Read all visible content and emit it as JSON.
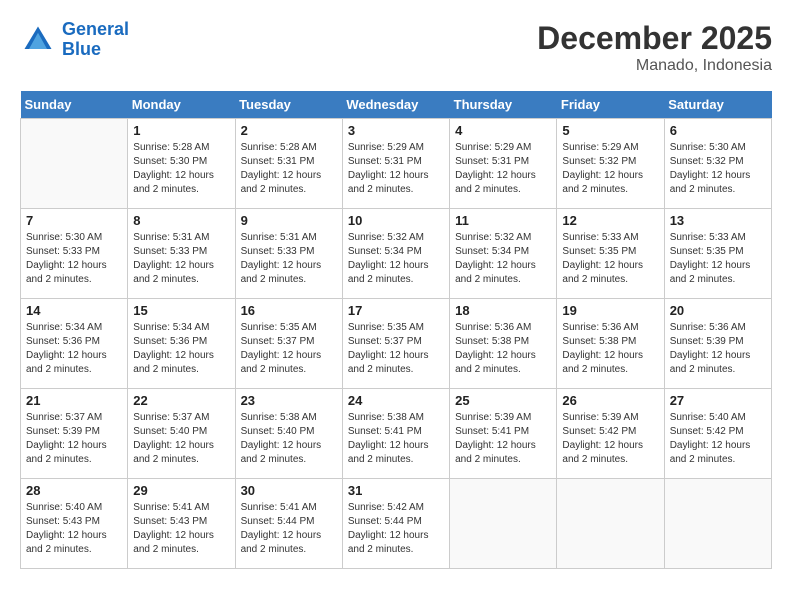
{
  "header": {
    "logo_line1": "General",
    "logo_line2": "Blue",
    "month": "December 2025",
    "location": "Manado, Indonesia"
  },
  "days_of_week": [
    "Sunday",
    "Monday",
    "Tuesday",
    "Wednesday",
    "Thursday",
    "Friday",
    "Saturday"
  ],
  "weeks": [
    [
      {
        "day": "",
        "info": ""
      },
      {
        "day": "1",
        "info": "Sunrise: 5:28 AM\nSunset: 5:30 PM\nDaylight: 12 hours\nand 2 minutes."
      },
      {
        "day": "2",
        "info": "Sunrise: 5:28 AM\nSunset: 5:31 PM\nDaylight: 12 hours\nand 2 minutes."
      },
      {
        "day": "3",
        "info": "Sunrise: 5:29 AM\nSunset: 5:31 PM\nDaylight: 12 hours\nand 2 minutes."
      },
      {
        "day": "4",
        "info": "Sunrise: 5:29 AM\nSunset: 5:31 PM\nDaylight: 12 hours\nand 2 minutes."
      },
      {
        "day": "5",
        "info": "Sunrise: 5:29 AM\nSunset: 5:32 PM\nDaylight: 12 hours\nand 2 minutes."
      },
      {
        "day": "6",
        "info": "Sunrise: 5:30 AM\nSunset: 5:32 PM\nDaylight: 12 hours\nand 2 minutes."
      }
    ],
    [
      {
        "day": "7",
        "info": "Sunrise: 5:30 AM\nSunset: 5:33 PM\nDaylight: 12 hours\nand 2 minutes."
      },
      {
        "day": "8",
        "info": "Sunrise: 5:31 AM\nSunset: 5:33 PM\nDaylight: 12 hours\nand 2 minutes."
      },
      {
        "day": "9",
        "info": "Sunrise: 5:31 AM\nSunset: 5:33 PM\nDaylight: 12 hours\nand 2 minutes."
      },
      {
        "day": "10",
        "info": "Sunrise: 5:32 AM\nSunset: 5:34 PM\nDaylight: 12 hours\nand 2 minutes."
      },
      {
        "day": "11",
        "info": "Sunrise: 5:32 AM\nSunset: 5:34 PM\nDaylight: 12 hours\nand 2 minutes."
      },
      {
        "day": "12",
        "info": "Sunrise: 5:33 AM\nSunset: 5:35 PM\nDaylight: 12 hours\nand 2 minutes."
      },
      {
        "day": "13",
        "info": "Sunrise: 5:33 AM\nSunset: 5:35 PM\nDaylight: 12 hours\nand 2 minutes."
      }
    ],
    [
      {
        "day": "14",
        "info": "Sunrise: 5:34 AM\nSunset: 5:36 PM\nDaylight: 12 hours\nand 2 minutes."
      },
      {
        "day": "15",
        "info": "Sunrise: 5:34 AM\nSunset: 5:36 PM\nDaylight: 12 hours\nand 2 minutes."
      },
      {
        "day": "16",
        "info": "Sunrise: 5:35 AM\nSunset: 5:37 PM\nDaylight: 12 hours\nand 2 minutes."
      },
      {
        "day": "17",
        "info": "Sunrise: 5:35 AM\nSunset: 5:37 PM\nDaylight: 12 hours\nand 2 minutes."
      },
      {
        "day": "18",
        "info": "Sunrise: 5:36 AM\nSunset: 5:38 PM\nDaylight: 12 hours\nand 2 minutes."
      },
      {
        "day": "19",
        "info": "Sunrise: 5:36 AM\nSunset: 5:38 PM\nDaylight: 12 hours\nand 2 minutes."
      },
      {
        "day": "20",
        "info": "Sunrise: 5:36 AM\nSunset: 5:39 PM\nDaylight: 12 hours\nand 2 minutes."
      }
    ],
    [
      {
        "day": "21",
        "info": "Sunrise: 5:37 AM\nSunset: 5:39 PM\nDaylight: 12 hours\nand 2 minutes."
      },
      {
        "day": "22",
        "info": "Sunrise: 5:37 AM\nSunset: 5:40 PM\nDaylight: 12 hours\nand 2 minutes."
      },
      {
        "day": "23",
        "info": "Sunrise: 5:38 AM\nSunset: 5:40 PM\nDaylight: 12 hours\nand 2 minutes."
      },
      {
        "day": "24",
        "info": "Sunrise: 5:38 AM\nSunset: 5:41 PM\nDaylight: 12 hours\nand 2 minutes."
      },
      {
        "day": "25",
        "info": "Sunrise: 5:39 AM\nSunset: 5:41 PM\nDaylight: 12 hours\nand 2 minutes."
      },
      {
        "day": "26",
        "info": "Sunrise: 5:39 AM\nSunset: 5:42 PM\nDaylight: 12 hours\nand 2 minutes."
      },
      {
        "day": "27",
        "info": "Sunrise: 5:40 AM\nSunset: 5:42 PM\nDaylight: 12 hours\nand 2 minutes."
      }
    ],
    [
      {
        "day": "28",
        "info": "Sunrise: 5:40 AM\nSunset: 5:43 PM\nDaylight: 12 hours\nand 2 minutes."
      },
      {
        "day": "29",
        "info": "Sunrise: 5:41 AM\nSunset: 5:43 PM\nDaylight: 12 hours\nand 2 minutes."
      },
      {
        "day": "30",
        "info": "Sunrise: 5:41 AM\nSunset: 5:44 PM\nDaylight: 12 hours\nand 2 minutes."
      },
      {
        "day": "31",
        "info": "Sunrise: 5:42 AM\nSunset: 5:44 PM\nDaylight: 12 hours\nand 2 minutes."
      },
      {
        "day": "",
        "info": ""
      },
      {
        "day": "",
        "info": ""
      },
      {
        "day": "",
        "info": ""
      }
    ]
  ]
}
